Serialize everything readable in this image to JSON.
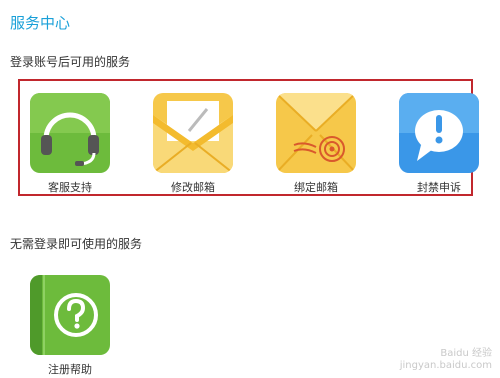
{
  "header": {
    "title": "服务中心"
  },
  "section_logged_in": {
    "title": "登录账号后可用的服务",
    "items": [
      {
        "label": "客服支持",
        "icon": "headset-icon"
      },
      {
        "label": "修改邮箱",
        "icon": "envelope-pen-icon"
      },
      {
        "label": "绑定邮箱",
        "icon": "envelope-seal-icon"
      },
      {
        "label": "封禁申诉",
        "icon": "exclamation-bubble-icon"
      }
    ]
  },
  "section_no_login": {
    "title": "无需登录即可使用的服务",
    "items": [
      {
        "label": "注册帮助",
        "icon": "question-book-icon"
      }
    ]
  },
  "watermark": {
    "line1": "Baidu 经验",
    "line2": "jingyan.baidu.com"
  },
  "colors": {
    "title_blue": "#1aa0d8",
    "highlight_red": "#c1272d",
    "tile_green": "#6dbb3c",
    "tile_yellow": "#f6c84a",
    "tile_blue": "#3a97e8"
  }
}
